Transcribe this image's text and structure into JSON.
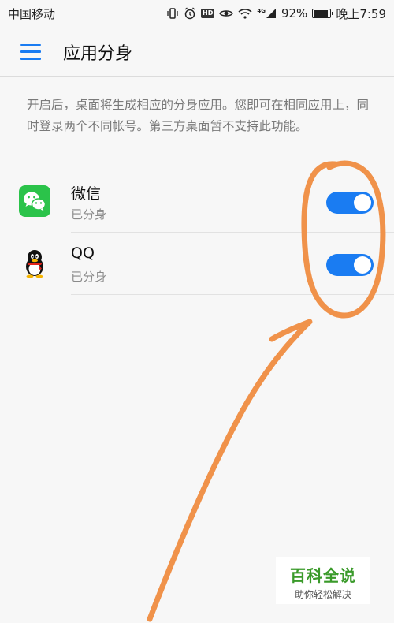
{
  "status_bar": {
    "carrier": "中国移动",
    "network": "4G",
    "battery": "92%",
    "time": "晚上7:59",
    "icons": [
      "vibrate-icon",
      "alarm-icon",
      "hd-icon",
      "eye-icon",
      "wifi-icon",
      "signal-icon",
      "battery-icon"
    ]
  },
  "header": {
    "title": "应用分身",
    "menu_icon": "menu-icon"
  },
  "description": "开启后，桌面将生成相应的分身应用。您即可在相同应用上，同时登录两个不同帐号。第三方桌面暂不支持此功能。",
  "apps": [
    {
      "name": "微信",
      "status": "已分身",
      "icon": "wechat-icon",
      "enabled": true
    },
    {
      "name": "QQ",
      "status": "已分身",
      "icon": "qq-icon",
      "enabled": true
    }
  ],
  "colors": {
    "accent": "#1a7cf2",
    "annotation": "#f0924a",
    "wechat": "#2bc34a"
  },
  "watermark": {
    "title": "百科全说",
    "subtitle": "助你轻松解决"
  }
}
